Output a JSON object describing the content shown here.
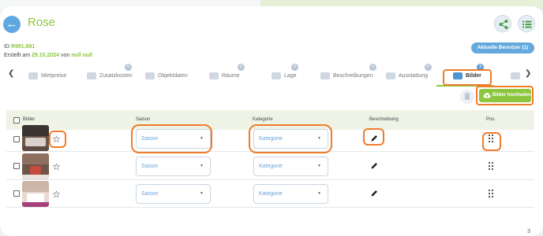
{
  "header": {
    "title": "Rose"
  },
  "meta": {
    "id_label": "ID",
    "id_value": "R991.891",
    "created_label": "Erstellt am",
    "created_date": "29.10.2024",
    "created_by_label": "von",
    "created_by": "null null"
  },
  "users_button": "Aktuelle Benutzer (1)",
  "tabs": [
    {
      "label": "Mietpreise",
      "badge": ""
    },
    {
      "label": "Zusatzkosten",
      "badge": "0"
    },
    {
      "label": "Objektdaten",
      "badge": ""
    },
    {
      "label": "Räume",
      "badge": "0"
    },
    {
      "label": "Lage",
      "badge": "0"
    },
    {
      "label": "Beschreibungen",
      "badge": "0"
    },
    {
      "label": "Ausstattung",
      "badge": "0"
    },
    {
      "label": "Bilder",
      "badge": "3",
      "active": true
    }
  ],
  "toolbar": {
    "upload_label": "Bilder hochladen"
  },
  "table": {
    "columns": [
      "Bilder",
      "Saison",
      "Kategorie",
      "Beschreibung",
      "Pos."
    ],
    "rows": [
      {
        "saison": "Saison",
        "kategorie": "Kategorie"
      },
      {
        "saison": "Saison",
        "kategorie": "Kategorie"
      },
      {
        "saison": "Saison",
        "kategorie": "Kategorie"
      }
    ]
  },
  "page_number": "3",
  "colors": {
    "accent_green": "#8cc63f",
    "accent_blue": "#64a9de",
    "highlight_orange": "#ef7c2a"
  }
}
